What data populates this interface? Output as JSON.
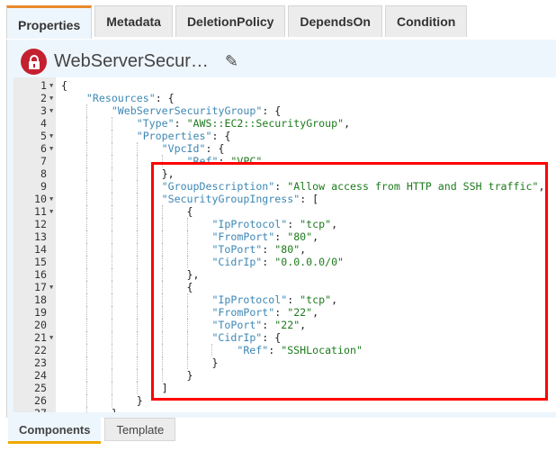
{
  "tabs": [
    "Properties",
    "Metadata",
    "DeletionPolicy",
    "DependsOn",
    "Condition"
  ],
  "header": {
    "title": "WebServerSecur…"
  },
  "bottom_tabs": [
    "Components",
    "Template"
  ],
  "lines": [
    {
      "i": 0,
      "f": true,
      "t": [
        [
          "p",
          "{"
        ]
      ]
    },
    {
      "i": 1,
      "f": true,
      "t": [
        [
          "k",
          "\"Resources\""
        ],
        [
          "p",
          ": {"
        ]
      ]
    },
    {
      "i": 2,
      "f": true,
      "t": [
        [
          "k",
          "\"WebServerSecurityGroup\""
        ],
        [
          "p",
          ": {"
        ]
      ]
    },
    {
      "i": 3,
      "f": false,
      "t": [
        [
          "k",
          "\"Type\""
        ],
        [
          "p",
          ": "
        ],
        [
          "s",
          "\"AWS::EC2::SecurityGroup\""
        ],
        [
          "p",
          ","
        ]
      ]
    },
    {
      "i": 3,
      "f": true,
      "t": [
        [
          "k",
          "\"Properties\""
        ],
        [
          "p",
          ": {"
        ]
      ]
    },
    {
      "i": 4,
      "f": true,
      "t": [
        [
          "k",
          "\"VpcId\""
        ],
        [
          "p",
          ": {"
        ]
      ]
    },
    {
      "i": 5,
      "f": false,
      "t": [
        [
          "k",
          "\"Ref\""
        ],
        [
          "p",
          ": "
        ],
        [
          "s",
          "\"VPC\""
        ]
      ]
    },
    {
      "i": 4,
      "f": false,
      "t": [
        [
          "p",
          "},"
        ]
      ]
    },
    {
      "i": 4,
      "f": false,
      "t": [
        [
          "k",
          "\"GroupDescription\""
        ],
        [
          "p",
          ": "
        ],
        [
          "s",
          "\"Allow access from HTTP and SSH traffic\""
        ],
        [
          "p",
          ","
        ]
      ]
    },
    {
      "i": 4,
      "f": true,
      "t": [
        [
          "k",
          "\"SecurityGroupIngress\""
        ],
        [
          "p",
          ": ["
        ]
      ]
    },
    {
      "i": 5,
      "f": true,
      "t": [
        [
          "p",
          "{"
        ]
      ]
    },
    {
      "i": 6,
      "f": false,
      "t": [
        [
          "k",
          "\"IpProtocol\""
        ],
        [
          "p",
          ": "
        ],
        [
          "s",
          "\"tcp\""
        ],
        [
          "p",
          ","
        ]
      ]
    },
    {
      "i": 6,
      "f": false,
      "t": [
        [
          "k",
          "\"FromPort\""
        ],
        [
          "p",
          ": "
        ],
        [
          "s",
          "\"80\""
        ],
        [
          "p",
          ","
        ]
      ]
    },
    {
      "i": 6,
      "f": false,
      "t": [
        [
          "k",
          "\"ToPort\""
        ],
        [
          "p",
          ": "
        ],
        [
          "s",
          "\"80\""
        ],
        [
          "p",
          ","
        ]
      ]
    },
    {
      "i": 6,
      "f": false,
      "t": [
        [
          "k",
          "\"CidrIp\""
        ],
        [
          "p",
          ": "
        ],
        [
          "s",
          "\"0.0.0.0/0\""
        ]
      ]
    },
    {
      "i": 5,
      "f": false,
      "t": [
        [
          "p",
          "},"
        ]
      ]
    },
    {
      "i": 5,
      "f": true,
      "t": [
        [
          "p",
          "{"
        ]
      ]
    },
    {
      "i": 6,
      "f": false,
      "t": [
        [
          "k",
          "\"IpProtocol\""
        ],
        [
          "p",
          ": "
        ],
        [
          "s",
          "\"tcp\""
        ],
        [
          "p",
          ","
        ]
      ]
    },
    {
      "i": 6,
      "f": false,
      "t": [
        [
          "k",
          "\"FromPort\""
        ],
        [
          "p",
          ": "
        ],
        [
          "s",
          "\"22\""
        ],
        [
          "p",
          ","
        ]
      ]
    },
    {
      "i": 6,
      "f": false,
      "t": [
        [
          "k",
          "\"ToPort\""
        ],
        [
          "p",
          ": "
        ],
        [
          "s",
          "\"22\""
        ],
        [
          "p",
          ","
        ]
      ]
    },
    {
      "i": 6,
      "f": true,
      "t": [
        [
          "k",
          "\"CidrIp\""
        ],
        [
          "p",
          ": {"
        ]
      ]
    },
    {
      "i": 7,
      "f": false,
      "t": [
        [
          "k",
          "\"Ref\""
        ],
        [
          "p",
          ": "
        ],
        [
          "s",
          "\"SSHLocation\""
        ]
      ]
    },
    {
      "i": 6,
      "f": false,
      "t": [
        [
          "p",
          "}"
        ]
      ]
    },
    {
      "i": 5,
      "f": false,
      "t": [
        [
          "p",
          "}"
        ]
      ]
    },
    {
      "i": 4,
      "f": false,
      "t": [
        [
          "p",
          "]"
        ]
      ]
    },
    {
      "i": 3,
      "f": false,
      "t": [
        [
          "p",
          "}"
        ]
      ]
    },
    {
      "i": 2,
      "f": false,
      "t": [
        [
          "p",
          "},"
        ]
      ]
    }
  ],
  "colors": {
    "highlight": "#ff0000",
    "lock": "#c42030",
    "active_tab": "#e8892b"
  }
}
